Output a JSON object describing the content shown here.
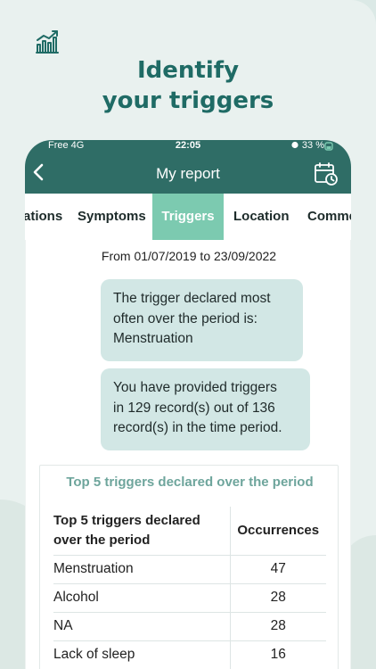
{
  "headline": {
    "line1": "Identify",
    "line2": "your triggers"
  },
  "icons": {
    "app": "chart-growth-icon",
    "back": "chevron-left-icon",
    "calendar": "calendar-clock-icon",
    "alarm": "alarm-icon",
    "battery": "battery-icon"
  },
  "status_bar": {
    "carrier": "Free  4G",
    "time": "22:05",
    "battery": "33 %"
  },
  "header": {
    "title": "My report"
  },
  "tabs": [
    {
      "label": "ations",
      "active": false
    },
    {
      "label": "Symptoms",
      "active": false
    },
    {
      "label": "Triggers",
      "active": true
    },
    {
      "label": "Location",
      "active": false
    },
    {
      "label": "Comme",
      "active": false
    }
  ],
  "period": "From 01/07/2019 to 23/09/2022",
  "bubbles": {
    "first": {
      "line1": "The trigger declared most",
      "line2": "often over the period is:",
      "line3": "Menstruation"
    },
    "second": {
      "line1": "You have provided triggers",
      "line2": "in 129 record(s) out of 136",
      "line3": "record(s) in the time period."
    }
  },
  "table": {
    "title": "Top 5 triggers declared over the period",
    "header": {
      "col1_line1": "Top 5 triggers declared",
      "col1_line2": "over the period",
      "col2": "Occurrences"
    },
    "rows": [
      {
        "trigger": "Menstruation",
        "count": "47"
      },
      {
        "trigger": "Alcohol",
        "count": "28"
      },
      {
        "trigger": "NA",
        "count": "28"
      },
      {
        "trigger": "Lack of sleep",
        "count": "16"
      }
    ]
  },
  "colors": {
    "brand_dark": "#2f6d66",
    "tab_active": "#7ccab0",
    "bubble": "#d2e7e5",
    "headline": "#1f6b65",
    "table_title": "#6ea59c"
  }
}
